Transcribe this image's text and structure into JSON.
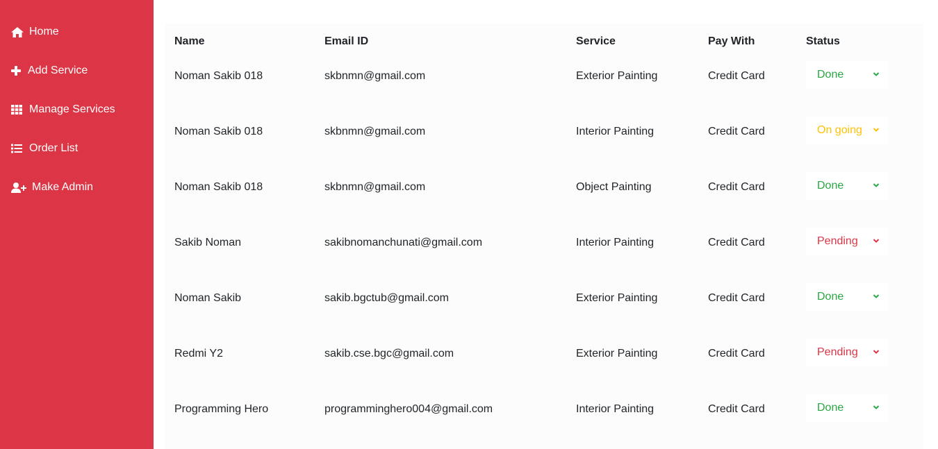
{
  "sidebar": {
    "items": [
      {
        "label": "Home",
        "icon": "home-icon"
      },
      {
        "label": "Add Service",
        "icon": "plus-icon"
      },
      {
        "label": "Manage Services",
        "icon": "grid-icon"
      },
      {
        "label": "Order List",
        "icon": "list-icon"
      },
      {
        "label": "Make Admin",
        "icon": "user-plus-icon"
      }
    ]
  },
  "table": {
    "headers": {
      "name": "Name",
      "email": "Email ID",
      "service": "Service",
      "pay": "Pay With",
      "status": "Status"
    },
    "rows": [
      {
        "name": "Noman Sakib 018",
        "email": "skbnmn@gmail.com",
        "service": "Exterior Painting",
        "pay": "Credit Card",
        "status": "Done"
      },
      {
        "name": "Noman Sakib 018",
        "email": "skbnmn@gmail.com",
        "service": "Interior Painting",
        "pay": "Credit Card",
        "status": "On going"
      },
      {
        "name": "Noman Sakib 018",
        "email": "skbnmn@gmail.com",
        "service": "Object Painting",
        "pay": "Credit Card",
        "status": "Done"
      },
      {
        "name": "Sakib Noman",
        "email": "sakibnomanchunati@gmail.com",
        "service": "Interior Painting",
        "pay": "Credit Card",
        "status": "Pending"
      },
      {
        "name": "Noman Sakib",
        "email": "sakib.bgctub@gmail.com",
        "service": "Exterior Painting",
        "pay": "Credit Card",
        "status": "Done"
      },
      {
        "name": "Redmi Y2",
        "email": "sakib.cse.bgc@gmail.com",
        "service": "Exterior Painting",
        "pay": "Credit Card",
        "status": "Pending"
      },
      {
        "name": "Programming Hero",
        "email": "programminghero004@gmail.com",
        "service": "Interior Painting",
        "pay": "Credit Card",
        "status": "Done"
      }
    ]
  },
  "colors": {
    "sidebar": "#dc3545",
    "done": "#28a745",
    "ongoing": "#ffc107",
    "pending": "#dc3545"
  }
}
